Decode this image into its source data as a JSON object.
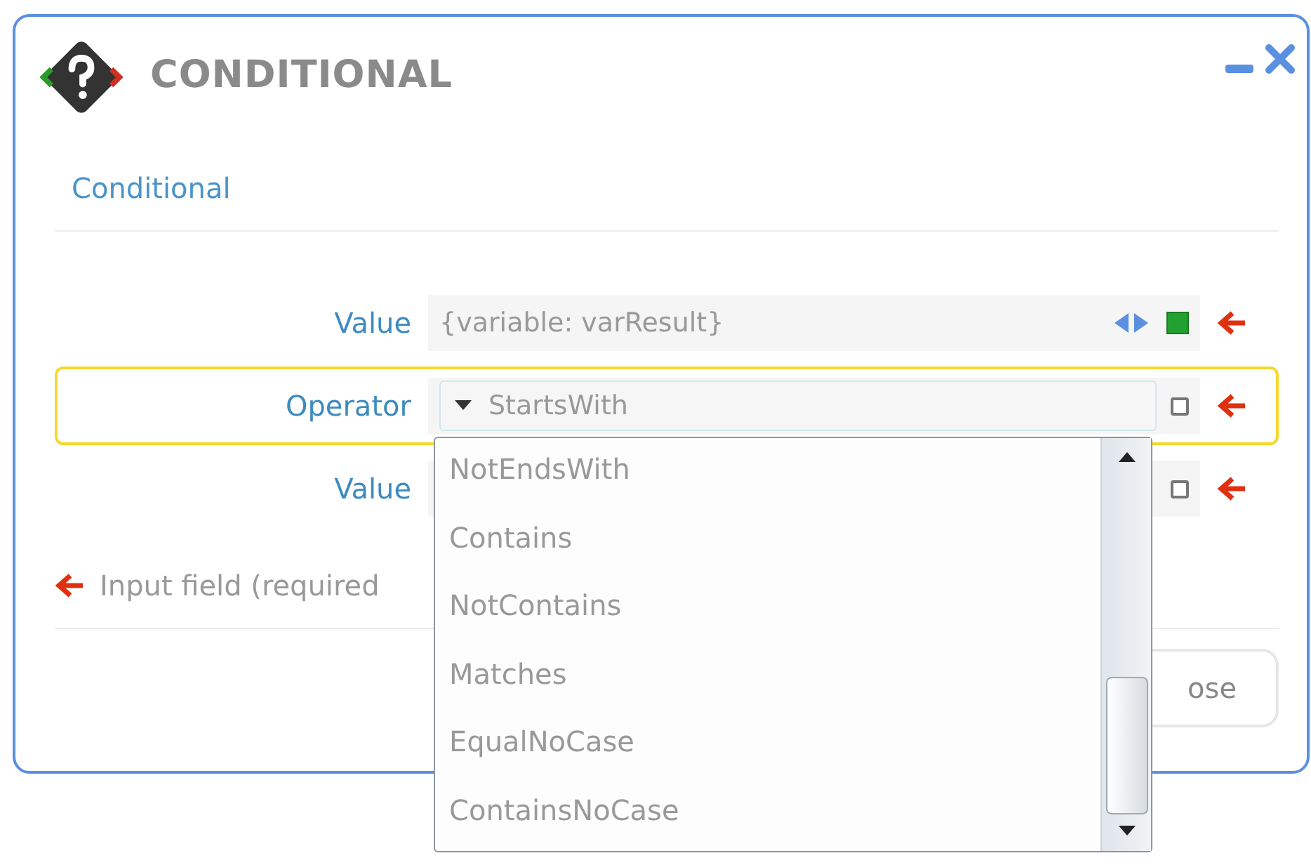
{
  "window": {
    "title": "CONDITIONAL"
  },
  "tab": {
    "label": "Conditional"
  },
  "rows": [
    {
      "kind": "text",
      "label": "Value",
      "value": "{variable: varResult}",
      "checked": true,
      "focused": false
    },
    {
      "kind": "select",
      "label": "Operator",
      "value": "StartsWith",
      "checked": false,
      "focused": true
    },
    {
      "kind": "text",
      "label": "Value",
      "value": "",
      "checked": false,
      "focused": false
    }
  ],
  "dropdown": {
    "options": [
      {
        "label": "NotEndsWith",
        "selected": false
      },
      {
        "label": "Contains",
        "selected": false
      },
      {
        "label": "NotContains",
        "selected": false
      },
      {
        "label": "Matches",
        "selected": false
      },
      {
        "label": "EqualNoCase",
        "selected": false
      },
      {
        "label": "ContainsNoCase",
        "selected": false
      }
    ]
  },
  "note": "Input field (required",
  "buttons": [
    "ose"
  ]
}
